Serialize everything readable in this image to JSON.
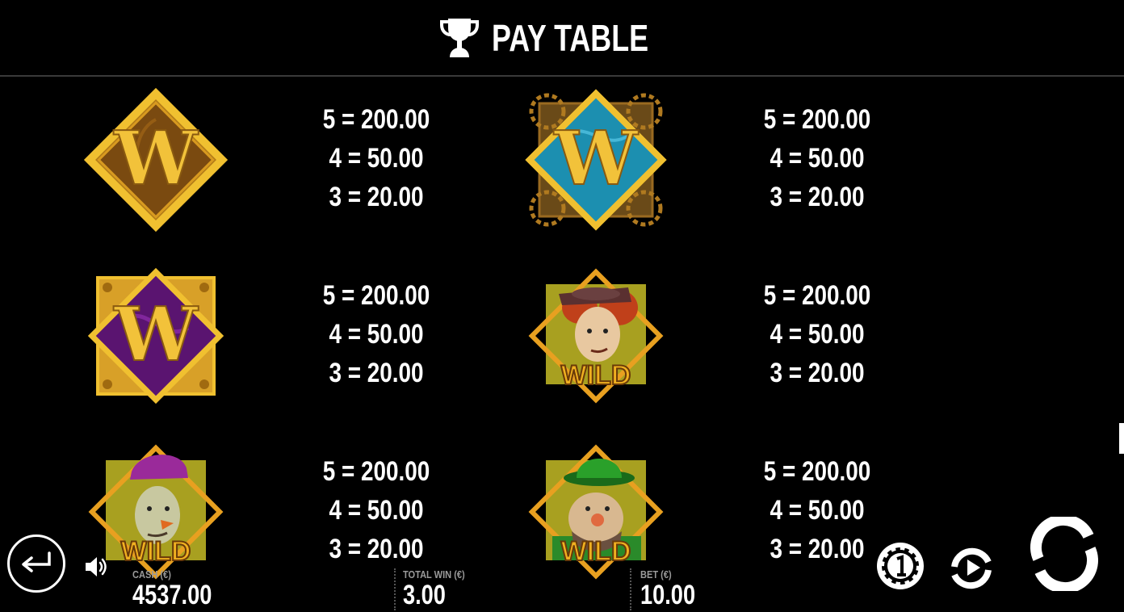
{
  "header": {
    "title": "PAY TABLE",
    "icon": "trophy-icon"
  },
  "symbols": [
    {
      "name": "W gold",
      "icon": "w-gold-symbol",
      "bg_color": "#8a5a14",
      "payouts": [
        "5 = 200.00",
        "4 = 50.00",
        "3 = 20.00"
      ]
    },
    {
      "name": "W blue",
      "icon": "w-blue-symbol",
      "bg_color": "#1c8fb0",
      "payouts": [
        "5 = 200.00",
        "4 = 50.00",
        "3 = 20.00"
      ]
    },
    {
      "name": "W purple",
      "icon": "w-purple-symbol",
      "bg_color": "#5a1470",
      "payouts": [
        "5 = 200.00",
        "4 = 50.00",
        "3 = 20.00"
      ]
    },
    {
      "name": "Red-haired woman wild",
      "icon": "wild-redhead-woman-symbol",
      "label": "WILD",
      "payouts": [
        "5 = 200.00",
        "4 = 50.00",
        "3 = 20.00"
      ]
    },
    {
      "name": "Purple-hat man wild",
      "icon": "wild-purple-hat-man-symbol",
      "label": "WILD",
      "payouts": [
        "5 = 200.00",
        "4 = 50.00",
        "3 = 20.00"
      ]
    },
    {
      "name": "Green-hat man wild",
      "icon": "wild-green-hat-man-symbol",
      "label": "WILD",
      "payouts": [
        "5 = 200.00",
        "4 = 50.00",
        "3 = 20.00"
      ]
    }
  ],
  "footer": {
    "cash_label": "CASH (€)",
    "cash_value": "4537.00",
    "total_win_label": "TOTAL WIN (€)",
    "total_win_value": "3.00",
    "bet_label": "BET (€)",
    "bet_value": "10.00"
  },
  "controls": {
    "back": "back-arrow-icon",
    "sound": "speaker-icon",
    "coin": "coin-value-icon",
    "autoplay": "autoplay-icon",
    "spin": "spin-icon"
  },
  "colors": {
    "gold": "#e8b425",
    "gold_dark": "#a86e10",
    "background": "#000000",
    "text": "#ffffff"
  }
}
